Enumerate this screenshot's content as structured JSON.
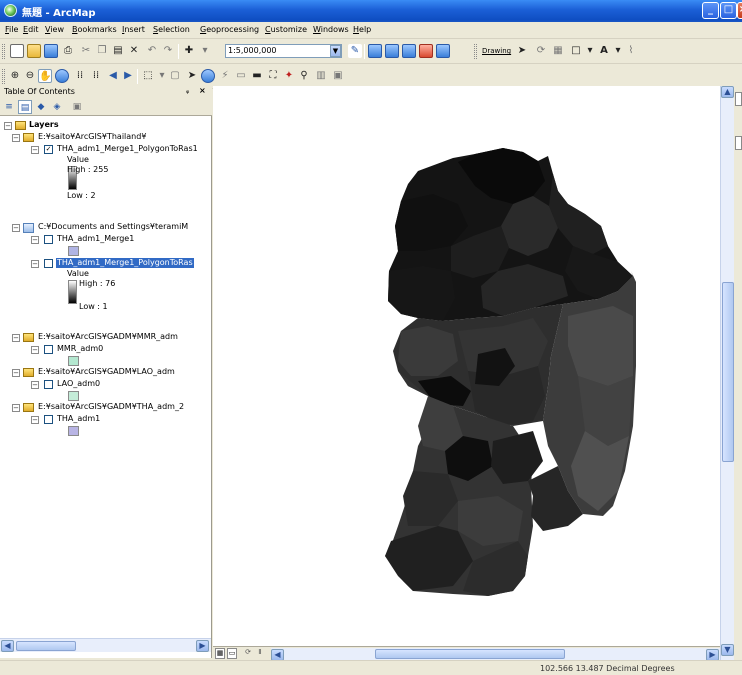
{
  "window": {
    "title": "無題 - ArcMap"
  },
  "menu": [
    "File",
    "Edit",
    "View",
    "Bookmarks",
    "Insert",
    "Selection",
    "Geoprocessing",
    "Customize",
    "Windows",
    "Help"
  ],
  "toolbar": {
    "scale": "1:5,000,000",
    "drawing_label": "Drawing"
  },
  "toc": {
    "title": "Table Of Contents",
    "pin": "# ×",
    "root": "Layers",
    "groups": [
      {
        "path": "E:¥saito¥ArcGIS¥Thailand¥",
        "layers": [
          {
            "name": "THA_adm1_Merge1_PolygonToRas1",
            "checked": true,
            "legend": {
              "title": "Value",
              "high": "High : 255",
              "low": "Low : 2"
            }
          }
        ]
      },
      {
        "path": "C:¥Documents and Settings¥teramiM",
        "layers": [
          {
            "name": "THA_adm1_Merge1",
            "checked": false,
            "swatch": "#b0b4e4"
          },
          {
            "name": "THA_adm1_Merge1_PolygonToRas",
            "checked": false,
            "selected": true,
            "legend": {
              "title": "Value",
              "high": "High : 76",
              "low": "Low : 1"
            }
          }
        ]
      },
      {
        "path": "E:¥saito¥ArcGIS¥GADM¥MMR_adm",
        "layers": [
          {
            "name": "MMR_adm0",
            "checked": false,
            "swatch": "#b4e8d0"
          }
        ]
      },
      {
        "path": "E:¥saito¥ArcGIS¥GADM¥LAO_adm",
        "layers": [
          {
            "name": "LAO_adm0",
            "checked": false,
            "swatch": "#c4ecd8"
          }
        ]
      },
      {
        "path": "E:¥saito¥ArcGIS¥GADM¥THA_adm_2",
        "layers": [
          {
            "name": "THA_adm1",
            "checked": false,
            "swatch": "#b8b4e4"
          }
        ]
      }
    ]
  },
  "status": {
    "coordinates": "102.566  13.487 Decimal Degrees"
  },
  "colors": {
    "selection": "#316ac5",
    "titlebar": "#0f4ec2"
  }
}
